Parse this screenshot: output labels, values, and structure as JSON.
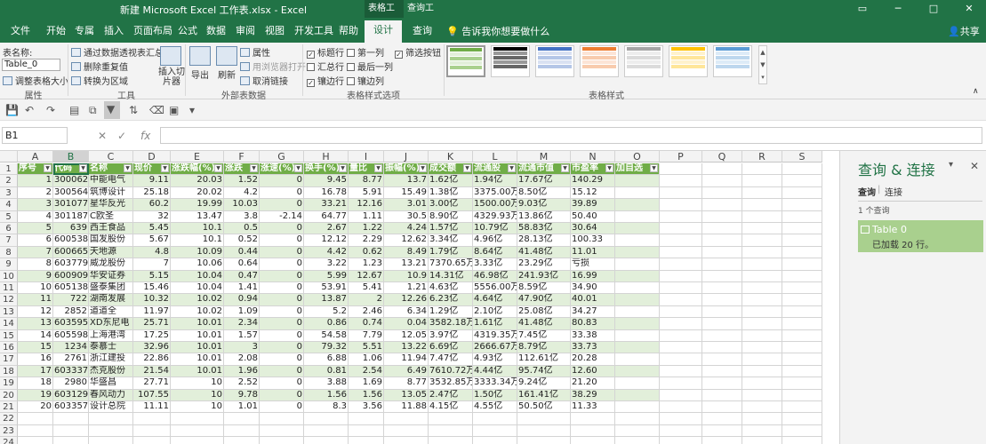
{
  "window": {
    "title": "新建 Microsoft Excel 工作表.xlsx - Excel",
    "context_tab_group": "表格工具",
    "context_tab_query": "查询工具"
  },
  "tabs": [
    "文件",
    "开始",
    "专属",
    "插入",
    "页面布局",
    "公式",
    "数据",
    "审阅",
    "视图",
    "开发工具",
    "帮助",
    "设计",
    "查询"
  ],
  "active_tab": "设计",
  "tell_me": "告诉我你想要做什么",
  "share": "共享",
  "ribbon": {
    "props": {
      "table_name_label": "表名称:",
      "table_name_value": "Table_0",
      "resize": "调整表格大小",
      "group": "属性"
    },
    "tools": {
      "pivot": "通过数据透视表汇总",
      "remove_dup": "删除重复值",
      "to_range": "转换为区域",
      "slicer": "插入切片器",
      "group": "工具"
    },
    "external": {
      "export": "导出",
      "refresh": "刷新",
      "properties": "属性",
      "open_browser": "用浏览器打开",
      "unlink": "取消链接",
      "group": "外部表数据"
    },
    "style_options": {
      "header_row": "标题行",
      "first_col": "第一列",
      "filter_btn": "筛选按钮",
      "total_row": "汇总行",
      "last_col": "最后一列",
      "banded_rows": "镶边行",
      "banded_cols": "镶边列",
      "group": "表格样式选项"
    },
    "styles_group": "表格样式"
  },
  "formula_bar": {
    "name_box": "B1",
    "fx": "fx"
  },
  "columns": [
    "A",
    "B",
    "C",
    "D",
    "E",
    "F",
    "G",
    "H",
    "I",
    "J",
    "K",
    "L",
    "M",
    "N",
    "O",
    "P",
    "Q",
    "R",
    "S"
  ],
  "table_headers": [
    "序号",
    "代码",
    "名称",
    "现价",
    "涨跌幅(%)",
    "涨跌",
    "涨速(%)",
    "换手(%)",
    "量比",
    "振幅(%)",
    "成交额",
    "流通股",
    "流通市值",
    "市盈率",
    "加自选"
  ],
  "rows": [
    [
      "1",
      "300062",
      "中能电气",
      "9.11",
      "20.03",
      "1.52",
      "0",
      "9.45",
      "8.77",
      "13.7",
      "1.62亿",
      "1.94亿",
      "17.67亿",
      "140.29",
      ""
    ],
    [
      "2",
      "300564",
      "筑博设计",
      "25.18",
      "20.02",
      "4.2",
      "0",
      "16.78",
      "5.91",
      "15.49",
      "1.38亿",
      "3375.00万",
      "8.50亿",
      "15.12",
      ""
    ],
    [
      "3",
      "301077",
      "星华反光",
      "60.2",
      "19.99",
      "10.03",
      "0",
      "33.21",
      "12.16",
      "3.01",
      "3.00亿",
      "1500.00万",
      "9.03亿",
      "39.89",
      ""
    ],
    [
      "4",
      "301187",
      "C欧圣",
      "32",
      "13.47",
      "3.8",
      "-2.14",
      "64.77",
      "1.11",
      "30.5",
      "8.90亿",
      "4329.93万",
      "13.86亿",
      "50.40",
      ""
    ],
    [
      "5",
      "639",
      "西王食品",
      "5.45",
      "10.1",
      "0.5",
      "0",
      "2.67",
      "1.22",
      "4.24",
      "1.57亿",
      "10.79亿",
      "58.83亿",
      "30.64",
      ""
    ],
    [
      "6",
      "600538",
      "国发股份",
      "5.67",
      "10.1",
      "0.52",
      "0",
      "12.12",
      "2.29",
      "12.62",
      "3.34亿",
      "4.96亿",
      "28.13亿",
      "100.33",
      ""
    ],
    [
      "7",
      "600665",
      "天地源",
      "4.8",
      "10.09",
      "0.44",
      "0",
      "4.42",
      "0.62",
      "8.49",
      "1.79亿",
      "8.64亿",
      "41.48亿",
      "11.01",
      ""
    ],
    [
      "8",
      "603779",
      "威龙股份",
      "7",
      "10.06",
      "0.64",
      "0",
      "3.22",
      "1.23",
      "13.21",
      "7370.65万",
      "3.33亿",
      "23.29亿",
      "亏损",
      ""
    ],
    [
      "9",
      "600909",
      "华安证券",
      "5.15",
      "10.04",
      "0.47",
      "0",
      "5.99",
      "12.67",
      "10.9",
      "14.31亿",
      "46.98亿",
      "241.93亿",
      "16.99",
      ""
    ],
    [
      "10",
      "605138",
      "盛泰集团",
      "15.46",
      "10.04",
      "1.41",
      "0",
      "53.91",
      "5.41",
      "1.21",
      "4.63亿",
      "5556.00万",
      "8.59亿",
      "34.90",
      ""
    ],
    [
      "11",
      "722",
      "湖南发展",
      "10.32",
      "10.02",
      "0.94",
      "0",
      "13.87",
      "2",
      "12.26",
      "6.23亿",
      "4.64亿",
      "47.90亿",
      "40.01",
      ""
    ],
    [
      "12",
      "2852",
      "道道全",
      "11.97",
      "10.02",
      "1.09",
      "0",
      "5.2",
      "2.46",
      "6.34",
      "1.29亿",
      "2.10亿",
      "25.08亿",
      "34.27",
      ""
    ],
    [
      "13",
      "603595",
      "XD东尼电",
      "25.71",
      "10.01",
      "2.34",
      "0",
      "0.86",
      "0.74",
      "0.04",
      "3582.18万",
      "1.61亿",
      "41.48亿",
      "80.83",
      ""
    ],
    [
      "14",
      "605598",
      "上海港湾",
      "17.25",
      "10.01",
      "1.57",
      "0",
      "54.58",
      "7.79",
      "12.05",
      "3.97亿",
      "4319.35万",
      "7.45亿",
      "33.38",
      ""
    ],
    [
      "15",
      "1234",
      "泰慕士",
      "32.96",
      "10.01",
      "3",
      "0",
      "79.32",
      "5.51",
      "13.22",
      "6.69亿",
      "2666.67万",
      "8.79亿",
      "33.73",
      ""
    ],
    [
      "16",
      "2761",
      "浙江建投",
      "22.86",
      "10.01",
      "2.08",
      "0",
      "6.88",
      "1.06",
      "11.94",
      "7.47亿",
      "4.93亿",
      "112.61亿",
      "20.28",
      ""
    ],
    [
      "17",
      "603337",
      "杰克股份",
      "21.54",
      "10.01",
      "1.96",
      "0",
      "0.81",
      "2.54",
      "6.49",
      "7610.72万",
      "4.44亿",
      "95.74亿",
      "12.60",
      ""
    ],
    [
      "18",
      "2980",
      "华盛昌",
      "27.71",
      "10",
      "2.52",
      "0",
      "3.88",
      "1.69",
      "8.77",
      "3532.85万",
      "3333.34万",
      "9.24亿",
      "21.20",
      ""
    ],
    [
      "19",
      "603129",
      "春风动力",
      "107.55",
      "10",
      "9.78",
      "0",
      "1.56",
      "1.56",
      "13.05",
      "2.47亿",
      "1.50亿",
      "161.41亿",
      "38.29",
      ""
    ],
    [
      "20",
      "603357",
      "设计总院",
      "11.11",
      "10",
      "1.01",
      "0",
      "8.3",
      "3.56",
      "11.88",
      "4.15亿",
      "4.55亿",
      "50.50亿",
      "11.33",
      ""
    ]
  ],
  "row_numbers": [
    "1",
    "2",
    "3",
    "4",
    "5",
    "6",
    "7",
    "8",
    "9",
    "10",
    "11",
    "12",
    "13",
    "14",
    "15",
    "16",
    "17",
    "18",
    "19",
    "20",
    "21",
    "22",
    "23",
    "24"
  ],
  "pane": {
    "title": "查询 & 连接",
    "tab_query": "查询",
    "tab_conn": "连接",
    "count": "1 个查询",
    "query_name": "Table 0",
    "query_status": "已加载 20 行。"
  },
  "colors": {
    "accent": "#217346",
    "table_header": "#70ad47",
    "band": "#e2efda"
  }
}
